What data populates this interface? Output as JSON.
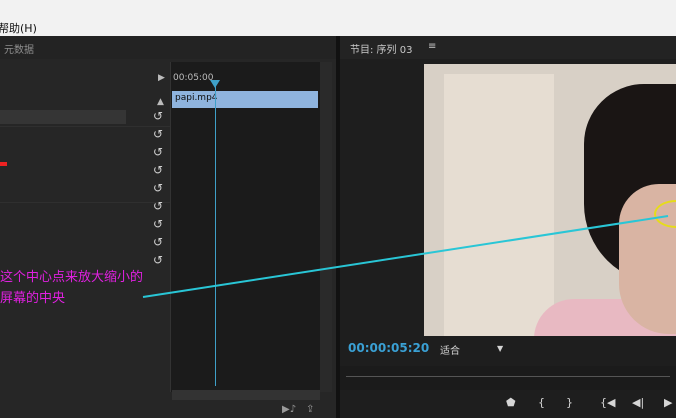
{
  "menu": {
    "item": "帮助(H)"
  },
  "left_panel": {
    "tab_label": "元数据",
    "timeline_time": "00:05:00",
    "clip_name": "papi.mp4"
  },
  "program_monitor": {
    "title": "节目: 序列 03",
    "menu_icon": "≡",
    "timecode": "00:00:05:20",
    "fit_label": "适合"
  },
  "annotation": {
    "line1": "这个中心点来放大缩小的",
    "line2": "屏幕的中央",
    "colors": {
      "text": "#e020e0",
      "arrow": "#29c6d6",
      "circle": "#e6dc1a"
    }
  },
  "controls": [
    "marker-icon",
    "in-point-icon",
    "out-point-icon",
    "go-to-in-icon",
    "step-back-icon",
    "play-icon"
  ]
}
